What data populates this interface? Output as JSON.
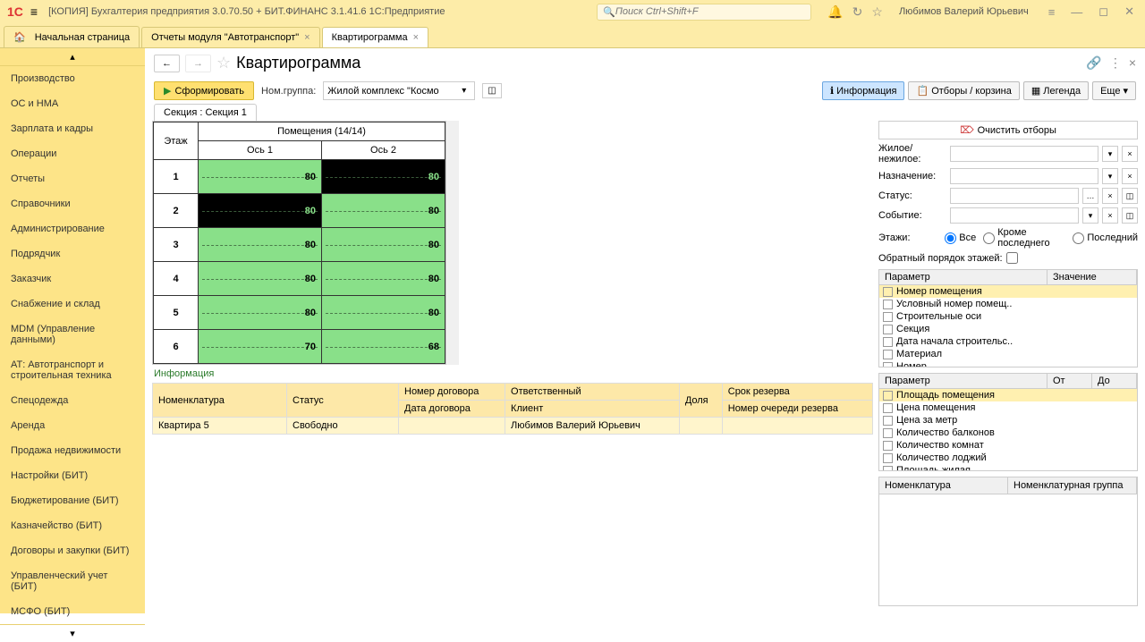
{
  "header": {
    "app_title": "[КОПИЯ] Бухгалтерия предприятия 3.0.70.50 + БИТ.ФИНАНС 3.1.41.6 1С:Предприятие",
    "search_placeholder": "Поиск Ctrl+Shift+F",
    "username": "Любимов Валерий Юрьевич"
  },
  "tabs": [
    {
      "label": "Начальная страница",
      "home": true,
      "closable": false
    },
    {
      "label": "Отчеты модуля \"Автотранспорт\"",
      "closable": true
    },
    {
      "label": "Квартирограмма",
      "closable": true,
      "active": true
    }
  ],
  "sidebar": {
    "items": [
      "Производство",
      "ОС и НМА",
      "Зарплата и кадры",
      "Операции",
      "Отчеты",
      "Справочники",
      "Администрирование",
      "Подрядчик",
      "Заказчик",
      "Снабжение и склад",
      "MDM (Управление данными)",
      "АТ: Автотранспорт и строительная техника",
      "Спецодежда",
      "Аренда",
      "Продажа недвижимости",
      "Настройки (БИТ)",
      "Бюджетирование (БИТ)",
      "Казначейство (БИТ)",
      "Договоры и закупки (БИТ)",
      "Управленческий учет (БИТ)",
      "МСФО (БИТ)"
    ]
  },
  "page": {
    "title": "Квартирограмма",
    "generate": "Сформировать",
    "nom_group_label": "Ном.группа:",
    "nom_group_value": "Жилой комплекс \"Космо",
    "btn_info": "Информация",
    "btn_filter": "Отборы / корзина",
    "btn_legend": "Легенда",
    "btn_more": "Еще"
  },
  "section_tab": "Секция : Секция 1",
  "grid": {
    "floor_header": "Этаж",
    "rooms_header": "Помещения (14/14)",
    "axis1": "Ось 1",
    "axis2": "Ось 2",
    "rows": [
      {
        "floor": "1",
        "cells": [
          {
            "v": "80",
            "c": "green"
          },
          {
            "v": "80",
            "c": "black"
          }
        ]
      },
      {
        "floor": "2",
        "cells": [
          {
            "v": "80",
            "c": "black"
          },
          {
            "v": "80",
            "c": "green"
          }
        ]
      },
      {
        "floor": "3",
        "cells": [
          {
            "v": "80",
            "c": "green"
          },
          {
            "v": "80",
            "c": "green"
          }
        ]
      },
      {
        "floor": "4",
        "cells": [
          {
            "v": "80",
            "c": "green"
          },
          {
            "v": "80",
            "c": "green"
          }
        ]
      },
      {
        "floor": "5",
        "cells": [
          {
            "v": "80",
            "c": "green"
          },
          {
            "v": "80",
            "c": "green"
          }
        ]
      },
      {
        "floor": "6",
        "cells": [
          {
            "v": "70",
            "c": "green"
          },
          {
            "v": "68",
            "c": "green"
          }
        ]
      }
    ]
  },
  "info": {
    "title": "Информация",
    "h_nom": "Номенклатура",
    "h_status": "Статус",
    "h_contract_no": "Номер договора",
    "h_contract_date": "Дата договора",
    "h_resp": "Ответственный",
    "h_client": "Клиент",
    "h_share": "Доля",
    "h_reserve": "Срок резерва",
    "h_queue": "Номер очереди резерва",
    "row_nom": "Квартира 5",
    "row_status": "Свободно",
    "row_resp": "Любимов Валерий Юрьевич"
  },
  "filters": {
    "clear": "Очистить отборы",
    "living": "Жилое/нежилое:",
    "purpose": "Назначение:",
    "status": "Статус:",
    "event": "Событие:",
    "floors": "Этажи:",
    "r_all": "Все",
    "r_except": "Кроме последнего",
    "r_last": "Последний",
    "reverse": "Обратный порядок этажей:",
    "h_param": "Параметр",
    "h_value": "Значение",
    "h_from": "От",
    "h_to": "До",
    "params1": [
      "Номер помещения",
      "Условный номер помещ..",
      "Строительные оси",
      "Секция",
      "Дата начала строительс..",
      "Материал",
      "Номер"
    ],
    "params2": [
      "Площадь помещения",
      "Цена помещения",
      "Цена за метр",
      "Количество балконов",
      "Количество комнат",
      "Количество лоджий",
      "Площадь жилая"
    ],
    "h_nomen": "Номенклатура",
    "h_nomen_group": "Номенклатурная группа"
  }
}
